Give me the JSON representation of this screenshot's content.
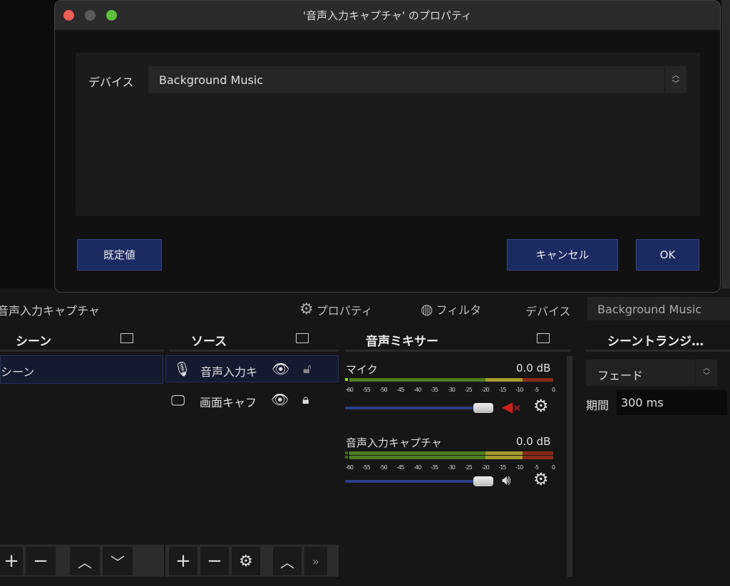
{
  "dialog": {
    "title": "'音声入力キャプチャ' のプロパティ",
    "device_label": "デバイス",
    "device_value": "Background Music",
    "defaults_button": "既定値",
    "cancel_button": "キャンセル",
    "ok_button": "OK",
    "traffic_lights": {
      "close": "#ec5f57",
      "minimize": "#5a5a5a",
      "zoom": "#5fc23f"
    }
  },
  "context_bar": {
    "source_name": "音声入力キャプチャ",
    "properties": "プロパティ",
    "filters": "フィルタ",
    "device_label": "デバイス",
    "device_value": "Background Music"
  },
  "scenes": {
    "title": "シーン",
    "items": [
      "シーン"
    ]
  },
  "sources": {
    "title": "ソース",
    "items": [
      {
        "name": "音声入力キ",
        "icon": "microphone-icon",
        "locked": false
      },
      {
        "name": "画面キャフ",
        "icon": "monitor-icon",
        "locked": true
      }
    ]
  },
  "mixer": {
    "title": "音声ミキサー",
    "ticks": [
      "-60",
      "-55",
      "-50",
      "-45",
      "-40",
      "-35",
      "-30",
      "-25",
      "-20",
      "-15",
      "-10",
      "-5",
      "0"
    ],
    "channels": [
      {
        "name": "マイク",
        "db": "0.0 dB",
        "muted": true,
        "volume": 1.0
      },
      {
        "name": "音声入力キャプチャ",
        "db": "0.0 dB",
        "muted": false,
        "volume": 1.0
      }
    ],
    "colors": {
      "green": "#4e7d1f",
      "yellow": "#a69b2c",
      "red": "#8a2a18",
      "slider": "#2d3d88",
      "mute": "#d0201b"
    }
  },
  "transitions": {
    "title": "シーントランジ…",
    "transition": "フェード",
    "duration_label": "期間",
    "duration_value": "300 ms"
  }
}
